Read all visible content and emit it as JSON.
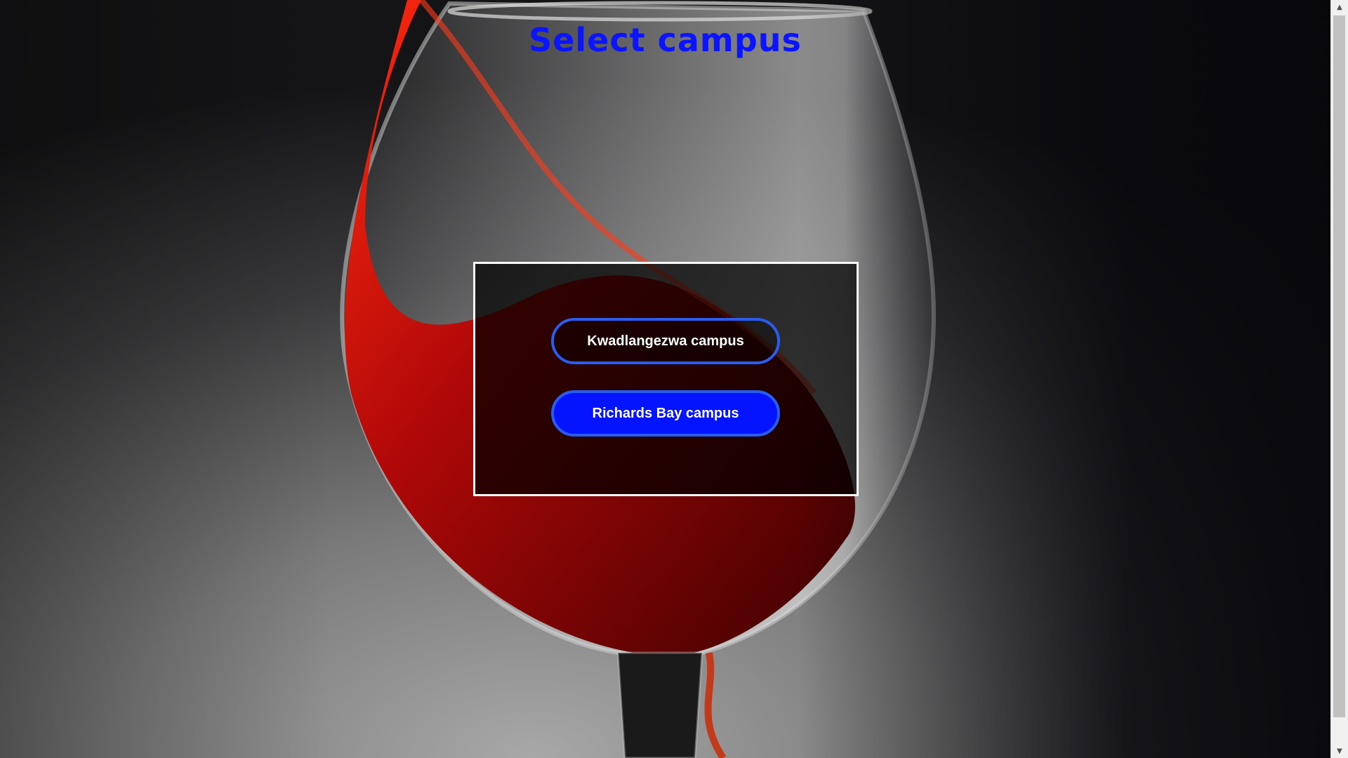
{
  "page": {
    "title": "Select campus"
  },
  "campus_selector": {
    "buttons": [
      {
        "label": "Kwadlangezwa campus"
      },
      {
        "label": "Richards Bay campus"
      }
    ]
  },
  "colors": {
    "title": "#0a14ff",
    "primary_button": "#0414ff",
    "button_border": "#2a5cf0",
    "panel_border": "#ffffff",
    "wine": "#c10a0a"
  },
  "background": {
    "image": "wine-glass-icon"
  },
  "scrollbar": {
    "up_arrow": "▲",
    "down_arrow": "▼"
  }
}
